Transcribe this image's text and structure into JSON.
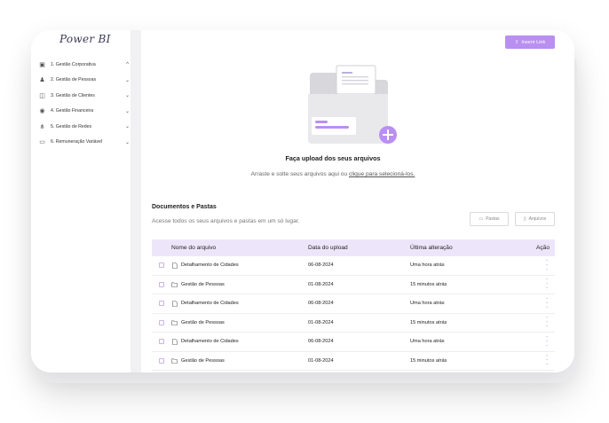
{
  "app": {
    "logo": "Power BI"
  },
  "sidebar": {
    "items": [
      {
        "label": "1. Gestão Corporativa",
        "icon": "building-icon",
        "glyph": "▣",
        "chev": "^"
      },
      {
        "label": "2. Gestão de Pessoas",
        "icon": "people-icon",
        "glyph": "♟",
        "chev": "⌄"
      },
      {
        "label": "3. Gestão de Clientes",
        "icon": "clients-icon",
        "glyph": "◫",
        "chev": "⌄"
      },
      {
        "label": "4. Gestão Financeira",
        "icon": "money-icon",
        "glyph": "◉",
        "chev": "⌄"
      },
      {
        "label": "5. Gestão de Redes",
        "icon": "network-icon",
        "glyph": "⋔",
        "chev": "⌄"
      },
      {
        "label": "6. Remuneração Variável",
        "icon": "wallet-icon",
        "glyph": "▭",
        "chev": "⌄"
      }
    ]
  },
  "toolbar": {
    "insert_link_label": "Inserir Link"
  },
  "upload": {
    "title": "Faça upload dos seus arquivos",
    "subtitle_prefix": "Arraste e solte seus arquivos aqui ou ",
    "subtitle_link": "clique para selecioná-los."
  },
  "documents": {
    "title": "Documentos e Pastas",
    "subtitle": "Acesse todos os seus arquivos e pastas em um só lugar.",
    "filter_folders": "Pastas",
    "filter_files": "Arquivos"
  },
  "table": {
    "headers": {
      "name": "Nome do arquivo",
      "date": "Data do upload",
      "modified": "Última alteração",
      "action": "Ação"
    },
    "rows": [
      {
        "type": "file",
        "name": "Detalhamento de Cidades",
        "date": "06-08-2024",
        "modified": "Uma hora atrás"
      },
      {
        "type": "folder",
        "name": "Gestão de Pessoas",
        "date": "01-08-2024",
        "modified": "15 minutos atrás"
      },
      {
        "type": "file",
        "name": "Detalhamento de Cidades",
        "date": "06-08-2024",
        "modified": "Uma hora atrás"
      },
      {
        "type": "folder",
        "name": "Gestão de Pessoas",
        "date": "01-08-2024",
        "modified": "15 minutos atrás"
      },
      {
        "type": "file",
        "name": "Detalhamento de Cidades",
        "date": "06-08-2024",
        "modified": "Uma hora atrás"
      },
      {
        "type": "folder",
        "name": "Gestão de Pessoas",
        "date": "01-08-2024",
        "modified": "15 minutos atrás"
      }
    ]
  },
  "colors": {
    "accent": "#b98ff2",
    "header_bg": "#ede6fb"
  }
}
